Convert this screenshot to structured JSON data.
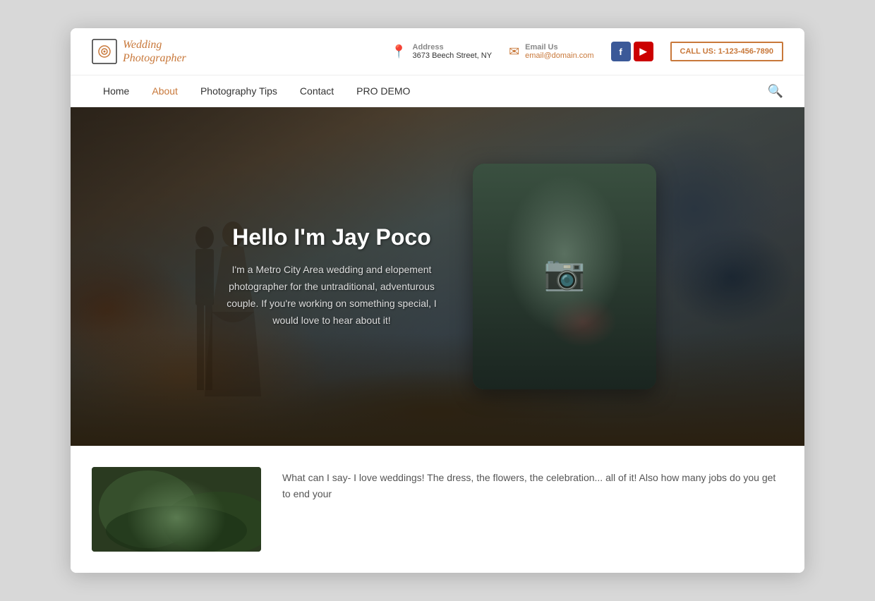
{
  "header": {
    "logo": {
      "text_line1": "Wedding",
      "text_line2": "Photographer"
    },
    "address": {
      "label": "Address",
      "value": "3673 Beech Street, NY"
    },
    "email": {
      "label": "Email Us",
      "value": "email@domain.com"
    },
    "call_button": "CALL US: 1-123-456-7890"
  },
  "nav": {
    "items": [
      {
        "label": "Home",
        "active": false
      },
      {
        "label": "About",
        "active": true
      },
      {
        "label": "Photography Tips",
        "active": false
      },
      {
        "label": "Contact",
        "active": false
      },
      {
        "label": "PRO DEMO",
        "active": false
      }
    ]
  },
  "hero": {
    "title": "Hello I'm Jay Poco",
    "subtitle": "I'm a Metro City Area wedding and elopement photographer for the untraditional, adventurous couple. If you're working on something special, I would love to hear about it!"
  },
  "below_fold": {
    "text": "What can I say- I love weddings! The dress, the flowers, the celebration... all of it! Also how many jobs do you get to end your"
  },
  "social": {
    "facebook": "f",
    "youtube": "▶"
  }
}
